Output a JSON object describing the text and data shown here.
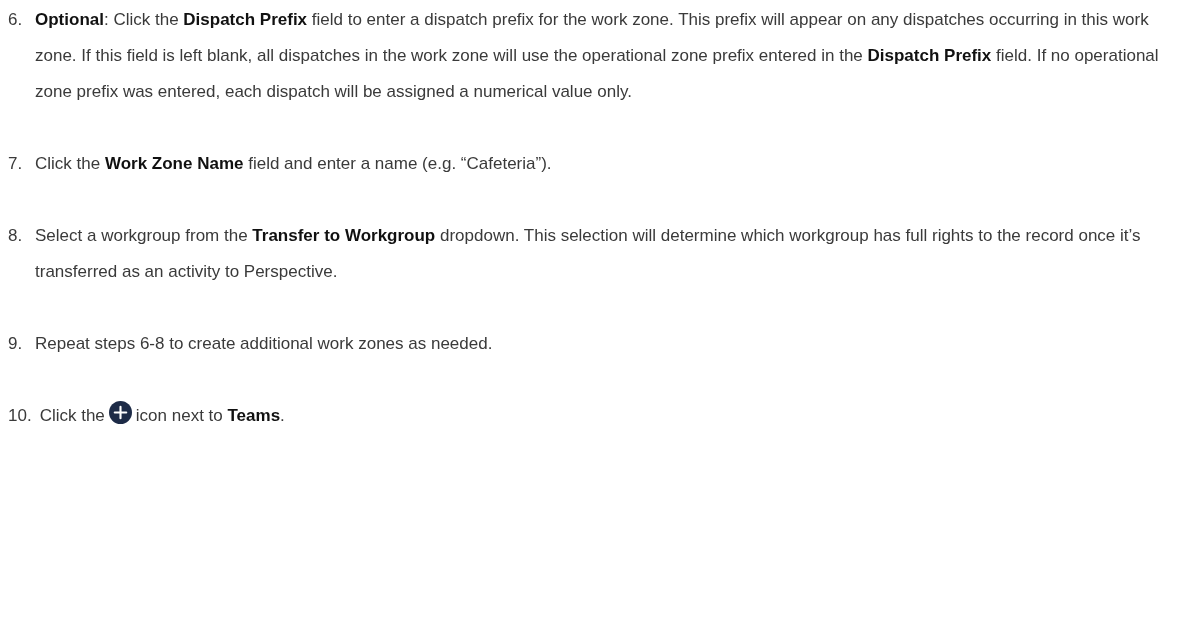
{
  "steps": [
    {
      "kind": "text",
      "number": "6.",
      "text": "**Optional**: Click the **Dispatch Prefix** field to enter a dispatch prefix for the work zone. This prefix will appear on any dispatches occurring in this work zone. If this field is left blank, all dispatches in the work zone will use the operational zone prefix entered in the **Dispatch Prefix** field. If no operational zone prefix was entered, each dispatch will be assigned a numerical value only."
    },
    {
      "kind": "text",
      "number": "7.",
      "text": "Click the **Work Zone Name** field and enter a name (e.g. “Cafeteria”)."
    },
    {
      "kind": "text",
      "number": "8.",
      "text": "Select a workgroup from the **Transfer to Workgroup** dropdown. This selection will determine which workgroup has full rights to the record once it’s transferred as an activity to Perspective."
    },
    {
      "kind": "text",
      "number": "9.",
      "text": "Repeat steps 6-8 to create additional work zones as needed."
    },
    {
      "kind": "icon",
      "number": "10.",
      "text_before": "Click the",
      "text_after": "icon next to **Teams**."
    }
  ]
}
